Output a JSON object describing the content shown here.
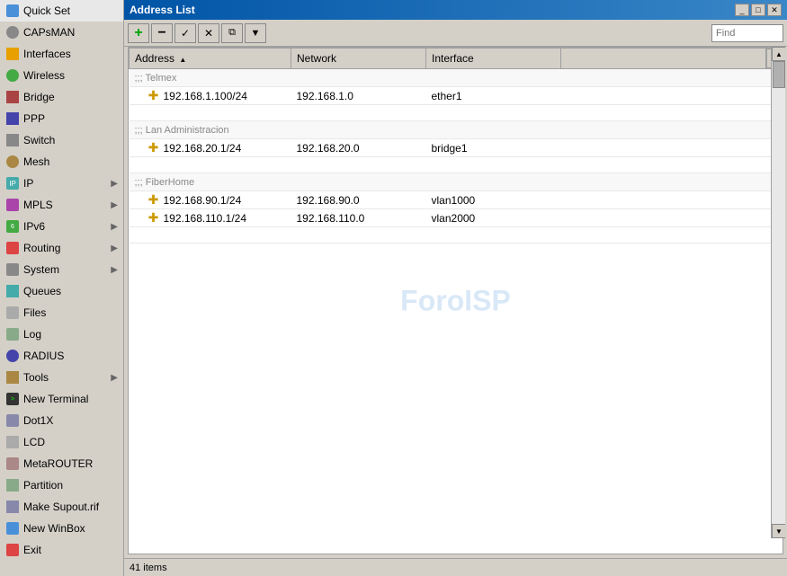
{
  "sidebar": {
    "items": [
      {
        "id": "quick-set",
        "label": "Quick Set",
        "icon": "quickset",
        "hasSubmenu": false
      },
      {
        "id": "capsman",
        "label": "CAPsMAN",
        "icon": "capsman",
        "hasSubmenu": false
      },
      {
        "id": "interfaces",
        "label": "Interfaces",
        "icon": "interfaces",
        "hasSubmenu": false
      },
      {
        "id": "wireless",
        "label": "Wireless",
        "icon": "wireless",
        "hasSubmenu": false
      },
      {
        "id": "bridge",
        "label": "Bridge",
        "icon": "bridge",
        "hasSubmenu": false
      },
      {
        "id": "ppp",
        "label": "PPP",
        "icon": "ppp",
        "hasSubmenu": false
      },
      {
        "id": "switch",
        "label": "Switch",
        "icon": "switch",
        "hasSubmenu": false
      },
      {
        "id": "mesh",
        "label": "Mesh",
        "icon": "mesh",
        "hasSubmenu": false
      },
      {
        "id": "ip",
        "label": "IP",
        "icon": "ip",
        "hasSubmenu": true
      },
      {
        "id": "mpls",
        "label": "MPLS",
        "icon": "mpls",
        "hasSubmenu": true
      },
      {
        "id": "ipv6",
        "label": "IPv6",
        "icon": "ipv6",
        "hasSubmenu": true
      },
      {
        "id": "routing",
        "label": "Routing",
        "icon": "routing",
        "hasSubmenu": true
      },
      {
        "id": "system",
        "label": "System",
        "icon": "system",
        "hasSubmenu": true
      },
      {
        "id": "queues",
        "label": "Queues",
        "icon": "queues",
        "hasSubmenu": false
      },
      {
        "id": "files",
        "label": "Files",
        "icon": "files",
        "hasSubmenu": false
      },
      {
        "id": "log",
        "label": "Log",
        "icon": "log",
        "hasSubmenu": false
      },
      {
        "id": "radius",
        "label": "RADIUS",
        "icon": "radius",
        "hasSubmenu": false
      },
      {
        "id": "tools",
        "label": "Tools",
        "icon": "tools",
        "hasSubmenu": true
      },
      {
        "id": "new-terminal",
        "label": "New Terminal",
        "icon": "terminal",
        "hasSubmenu": false
      },
      {
        "id": "dot1x",
        "label": "Dot1X",
        "icon": "dot1x",
        "hasSubmenu": false
      },
      {
        "id": "lcd",
        "label": "LCD",
        "icon": "lcd",
        "hasSubmenu": false
      },
      {
        "id": "meta-router",
        "label": "MetaROUTER",
        "icon": "meta",
        "hasSubmenu": false
      },
      {
        "id": "partition",
        "label": "Partition",
        "icon": "partition",
        "hasSubmenu": false
      },
      {
        "id": "make-supout",
        "label": "Make Supout.rif",
        "icon": "supout",
        "hasSubmenu": false
      },
      {
        "id": "new-winbox",
        "label": "New WinBox",
        "icon": "winbox",
        "hasSubmenu": false
      },
      {
        "id": "exit",
        "label": "Exit",
        "icon": "exit",
        "hasSubmenu": false
      }
    ]
  },
  "window": {
    "title": "Address List",
    "controls": [
      "_",
      "□",
      "✕"
    ]
  },
  "toolbar": {
    "buttons": [
      "+",
      "-",
      "✓",
      "✕",
      "⧉",
      "▼"
    ],
    "search_placeholder": "Find"
  },
  "table": {
    "columns": [
      {
        "id": "address",
        "label": "Address",
        "sortable": true
      },
      {
        "id": "network",
        "label": "Network",
        "sortable": false
      },
      {
        "id": "interface",
        "label": "Interface",
        "sortable": false
      },
      {
        "id": "extra",
        "label": "",
        "sortable": false
      }
    ],
    "groups": [
      {
        "name": ";;; Telmex",
        "rows": [
          {
            "address": "192.168.1.100/24",
            "network": "192.168.1.0",
            "interface": "ether1"
          }
        ]
      },
      {
        "name": ";;; Lan Administracion",
        "rows": [
          {
            "address": "192.168.20.1/24",
            "network": "192.168.20.0",
            "interface": "bridge1"
          }
        ]
      },
      {
        "name": ";;; FiberHome",
        "rows": [
          {
            "address": "192.168.90.1/24",
            "network": "192.168.90.0",
            "interface": "vlan1000"
          },
          {
            "address": "192.168.110.1/24",
            "network": "192.168.110.0",
            "interface": "vlan2000"
          }
        ]
      }
    ]
  },
  "status": {
    "count_label": "41 items"
  },
  "watermark": {
    "text": "ForoISP"
  }
}
